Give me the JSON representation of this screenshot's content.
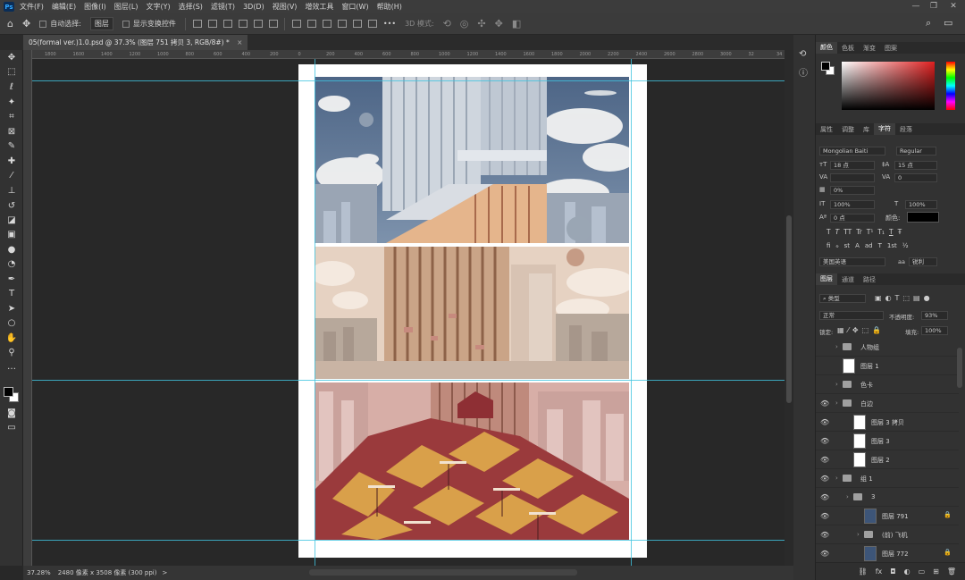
{
  "menubar": {
    "logo": "Ps",
    "items": [
      "文件(F)",
      "编辑(E)",
      "图像(I)",
      "图层(L)",
      "文字(Y)",
      "选择(S)",
      "滤镜(T)",
      "3D(D)",
      "视图(V)",
      "增效工具",
      "窗口(W)",
      "帮助(H)"
    ],
    "win": [
      "—",
      "❐",
      "✕"
    ]
  },
  "options": {
    "auto_select_label": "自动选择:",
    "auto_select_value": "图层",
    "transform_label": "显示变换控件",
    "mode_label": "3D 模式:",
    "more": "•••"
  },
  "document": {
    "tab_title": "05(formal ver.)1.0.psd @ 37.3% (图层 751 拷贝 3, RGB/8#) *",
    "tab_close": "×"
  },
  "ruler": {
    "top_ticks": [
      "1800",
      "1600",
      "1400",
      "1200",
      "1000",
      "800",
      "600",
      "400",
      "200",
      "0",
      "200",
      "400",
      "600",
      "800",
      "1000",
      "1200",
      "1400",
      "1600",
      "1800",
      "2000",
      "2200",
      "2400",
      "2600",
      "2800",
      "3000",
      "32",
      "34"
    ]
  },
  "status": {
    "zoom": "37.28%",
    "doc_info": "2480 像素 x 3508 像素 (300 ppi)",
    "arrow": ">"
  },
  "color_panel": {
    "tabs": [
      "颜色",
      "色板",
      "渐变",
      "图案"
    ],
    "active": "颜色"
  },
  "char_panel": {
    "tabs": [
      "属性",
      "调整",
      "库",
      "字符",
      "段落"
    ],
    "active": "字符",
    "font": "Mongolian Baiti",
    "style": "Regular",
    "size": "18 点",
    "leading": "15 点",
    "kerning": "",
    "tracking": "0",
    "tsume": "0%",
    "vscale": "100%",
    "hscale": "100%",
    "baseline": "0 点",
    "color_label": "颜色:",
    "language": "美国英语",
    "aa_prefix": "aa",
    "aa": "锐利",
    "style_buttons": [
      "T",
      "T",
      "TT",
      "Tr",
      "T¹",
      "T₁",
      "T",
      "Ŧ"
    ],
    "ot_buttons": [
      "fi",
      "ℴ",
      "st",
      "A",
      "ad",
      "T",
      "1st",
      "½"
    ]
  },
  "layers_panel": {
    "tabs": [
      "图层",
      "通道",
      "路径"
    ],
    "active": "图层",
    "filter_label": "类型",
    "blend_mode": "正常",
    "opacity_label": "不透明度:",
    "opacity": "93%",
    "lock_label": "锁定:",
    "fill_label": "填充:",
    "fill": "100%",
    "layers": [
      {
        "name": "人物组",
        "type": "folder",
        "visible": false,
        "indent": 0,
        "lock": false
      },
      {
        "name": "图层 1",
        "type": "layer",
        "visible": false,
        "indent": 0,
        "lock": false
      },
      {
        "name": "色卡",
        "type": "folder",
        "visible": false,
        "indent": 0,
        "lock": false
      },
      {
        "name": "白边",
        "type": "folder",
        "visible": true,
        "indent": 0,
        "lock": false
      },
      {
        "name": "图层 3 拷贝",
        "type": "layer",
        "visible": true,
        "indent": 1,
        "lock": false
      },
      {
        "name": "图层 3",
        "type": "layer",
        "visible": true,
        "indent": 1,
        "lock": false
      },
      {
        "name": "图层 2",
        "type": "layer",
        "visible": true,
        "indent": 1,
        "lock": false
      },
      {
        "name": "组 1",
        "type": "folder",
        "visible": true,
        "indent": 0,
        "lock": false
      },
      {
        "name": "3",
        "type": "folder",
        "visible": true,
        "indent": 1,
        "lock": false
      },
      {
        "name": "图层 791",
        "type": "layer-blue",
        "visible": true,
        "indent": 2,
        "lock": true
      },
      {
        "name": "(前) 飞机",
        "type": "folder",
        "visible": true,
        "indent": 2,
        "lock": false
      },
      {
        "name": "图层 772",
        "type": "layer-blue",
        "visible": true,
        "indent": 2,
        "lock": true
      }
    ],
    "footer_icons": [
      "link-icon",
      "fx-icon",
      "mask-icon",
      "adjustment-icon",
      "group-icon",
      "new-layer-icon",
      "trash-icon"
    ]
  },
  "colors": {
    "accent_blue": "#31a8ff",
    "guide": "#40c4e0",
    "foreground": "#000000",
    "background": "#ffffff"
  }
}
